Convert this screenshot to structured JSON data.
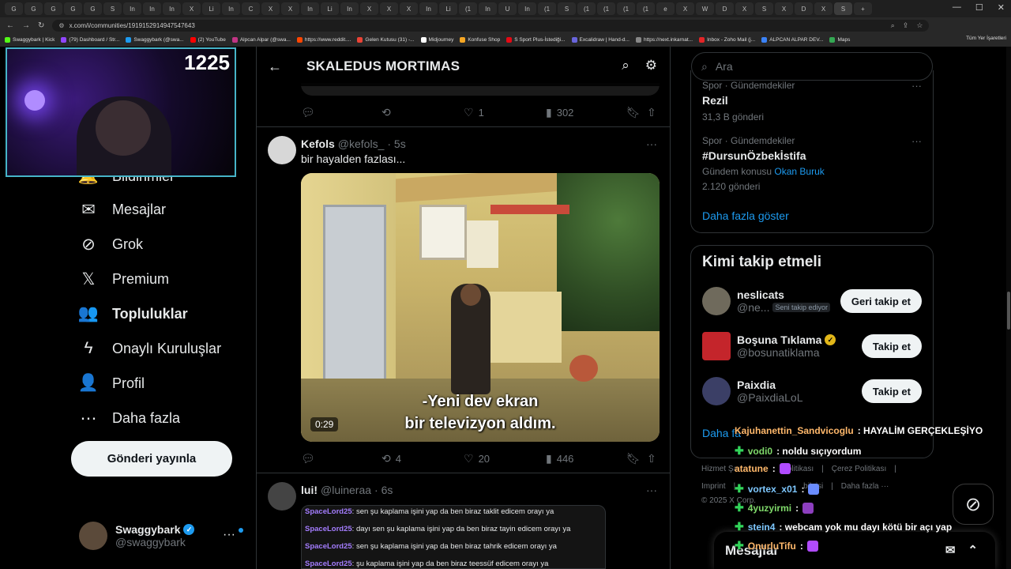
{
  "browser": {
    "tabs": [
      "G",
      "G",
      "G",
      "G",
      "G",
      "S",
      "In",
      "In",
      "In",
      "X",
      "Li",
      "In",
      "C",
      "X",
      "X",
      "In",
      "Li",
      "In",
      "X",
      "X",
      "X",
      "In",
      "Li",
      "(1",
      "In",
      "U",
      "In",
      "(1",
      "S",
      "(1",
      "(1",
      "(1",
      "(1",
      "e",
      "X",
      "W",
      "D",
      "X",
      "S",
      "X",
      "D",
      "X",
      "S"
    ],
    "url": "x.com/i/communities/1919152914947547643",
    "bookmarks": [
      "Swaggybark | Kick",
      "(79) Dashboard / Str...",
      "Swaggybark (@swa...",
      "(2) YouTube",
      "Alpcan Alpar (@swa...",
      "https://www.reddit....",
      "Gelen Kutusu (31) -...",
      "Midjourney",
      "Konfuse Shop",
      "S Sport Plus-İstediği...",
      "Excalidraw | Hand-d...",
      "https://next.inkarnat...",
      "Inbox - Zoho Mail (j...",
      "ALPCAN ALPAR DEV...",
      "Maps"
    ],
    "bookmarks_right": "Tüm Yer İşaretleri"
  },
  "webcam": {
    "viewer_count": "1225"
  },
  "nav": {
    "items": [
      {
        "label": "Bildirimler",
        "icon": "bell-icon"
      },
      {
        "label": "Mesajlar",
        "icon": "mail-icon"
      },
      {
        "label": "Grok",
        "icon": "grok-icon"
      },
      {
        "label": "Premium",
        "icon": "x-logo-icon"
      },
      {
        "label": "Topluluklar",
        "icon": "communities-icon"
      },
      {
        "label": "Onaylı Kuruluşlar",
        "icon": "lightning-icon"
      },
      {
        "label": "Profil",
        "icon": "profile-icon"
      },
      {
        "label": "Daha fazla",
        "icon": "more-circle-icon"
      }
    ],
    "post_button": "Gönderi yayınla",
    "account": {
      "name": "Swaggybark",
      "handle": "@swaggybark"
    }
  },
  "header": {
    "title": "SKALEDUS MORTIMAS"
  },
  "posts": [
    {
      "actions": {
        "replies": "",
        "reposts": "",
        "likes": "1",
        "views": "302"
      }
    },
    {
      "name": "Kefols",
      "handle": "@kefols_",
      "time": "· 5s",
      "text": "bir hayalden fazlası...",
      "video": {
        "subtitle_1": "-Yeni dev ekran",
        "subtitle_2": "bir televizyon aldım.",
        "duration": "0:29"
      },
      "actions": {
        "replies": "",
        "reposts": "4",
        "likes": "20",
        "views": "446"
      }
    },
    {
      "name": "lui!",
      "handle": "@luineraa",
      "time": "· 6s",
      "chat": [
        {
          "user": "SpaceLord25",
          "msg": ": sen şu kaplama işini yap da ben biraz taklit edicem orayı ya"
        },
        {
          "user": "SpaceLord25",
          "msg": ": dayı sen şu kaplama işini yap da ben biraz tayin edicem orayı ya"
        },
        {
          "user": "SpaceLord25",
          "msg": ": sen şu kaplama işini yap da ben biraz tahrik edicem orayı ya"
        },
        {
          "user": "SpaceLord25",
          "msg": ": şu kaplama işini yap da ben biraz teessüf edicem orayı ya"
        }
      ]
    }
  ],
  "sidebar": {
    "search_placeholder": "Ara",
    "trends": [
      {
        "category": "Spor · Gündemdekiler",
        "title": "Rezil",
        "count": "31,3 B gönderi"
      },
      {
        "category": "Spor · Gündemdekiler",
        "title": "#DursunÖzbekİstifa",
        "topic_prefix": "Gündem konusu",
        "topic_link": "Okan Buruk",
        "count": "2.120 gönderi"
      }
    ],
    "show_more": "Daha fazla göster",
    "who_to_follow": {
      "title": "Kimi takip etmeli",
      "users": [
        {
          "name": "neslicats",
          "handle": "@ne...",
          "tag": "Seni takip ediyor",
          "button": "Geri takip et"
        },
        {
          "name": "Boşuna Tıklama",
          "handle": "@bosunatiklama",
          "button": "Takip et"
        },
        {
          "name": "Paixdia",
          "handle": "@PaixdiaLoL",
          "button": "Takip et"
        }
      ],
      "show_more": "Daha fa"
    },
    "footer": {
      "line1": [
        "Hizmet Şa",
        "Politikası",
        "|",
        "Çerez Politikası",
        "|"
      ],
      "line2": [
        "Imprint",
        "|",
        "bilgisi",
        "|",
        "Daha fazla ···"
      ],
      "copyright": "© 2025 X Corp."
    }
  },
  "messages": {
    "label": "Mesajlar"
  },
  "overlay_chat": [
    {
      "user": "Kajuhanettin_Sandvicoglu",
      "msg": ": HAYALİM GERÇEKLEŞİYO",
      "plus": false
    },
    {
      "user": "vodi0",
      "msg": ": noldu sıçıyordum",
      "plus": true
    },
    {
      "user": "atatune",
      "msg": ":",
      "plus": false
    },
    {
      "user": "vortex_x01",
      "msg": ":",
      "plus": true
    },
    {
      "user": "4yuzyirmi",
      "msg": ":",
      "plus": true
    },
    {
      "user": "stein4",
      "msg": ": webcam yok mu dayı kötü bir açı yap",
      "plus": true
    },
    {
      "user": "OnurluTifu",
      "msg": ":",
      "plus": true
    }
  ]
}
